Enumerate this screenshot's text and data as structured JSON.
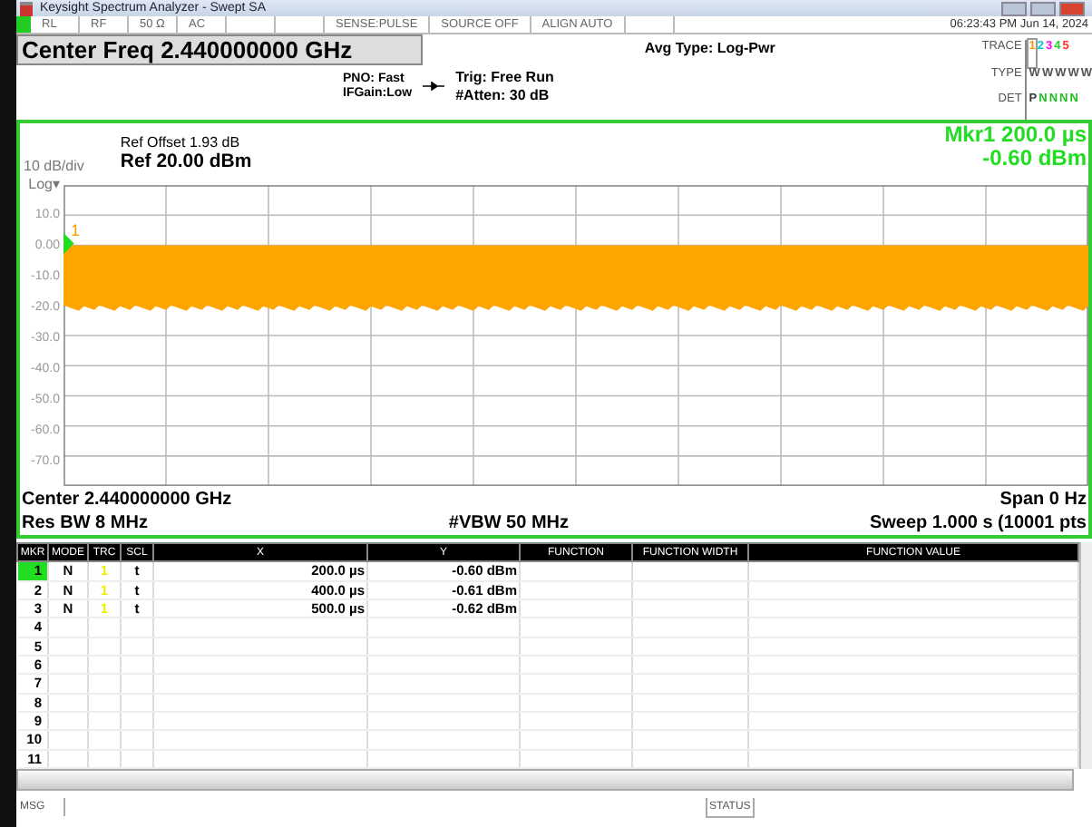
{
  "window": {
    "title": "Keysight Spectrum Analyzer - Swept SA"
  },
  "status_row": {
    "cells": [
      "RL",
      "RF",
      "50 Ω",
      "AC",
      "",
      "",
      "SENSE:PULSE",
      "SOURCE OFF",
      "ALIGN AUTO",
      ""
    ],
    "time": "06:23:43 PM Jun 14, 2024"
  },
  "center_freq": "Center Freq 2.440000000 GHz",
  "settings": {
    "pno": "PNO: Fast",
    "ifgain": "IFGain:Low",
    "trig": "Trig: Free Run",
    "atten": "#Atten: 30 dB",
    "avg_type": "Avg Type: Log-Pwr"
  },
  "trace_info": {
    "trace_label": "TRACE",
    "type_label": "TYPE",
    "det_label": "DET",
    "traces": [
      {
        "number": "1",
        "type": "W",
        "det": "P",
        "color": "#ff9900",
        "selected": true
      },
      {
        "number": "2",
        "type": "W",
        "det": "N",
        "color": "#00c8c8",
        "selected": false
      },
      {
        "number": "3",
        "type": "W",
        "det": "N",
        "color": "#ff00ff",
        "selected": false
      },
      {
        "number": "4",
        "type": "W",
        "det": "N",
        "color": "#33cc33",
        "selected": false
      },
      {
        "number": "5",
        "type": "W",
        "det": "N",
        "color": "#ff3333",
        "selected": false
      }
    ]
  },
  "graph": {
    "scale": "10 dB/div",
    "log": "Log▾",
    "ref_offset": "Ref Offset 1.93 dB",
    "ref_level": "Ref 20.00 dBm",
    "marker_x": "Mkr1 200.0 µs",
    "marker_y": "-0.60 dBm",
    "marker_label": "1",
    "y_labels": [
      "10.0",
      "0.00",
      "-10.0",
      "-20.0",
      "-30.0",
      "-40.0",
      "-50.0",
      "-60.0",
      "-70.0"
    ],
    "center": "Center 2.440000000 GHz",
    "span": "Span 0 Hz",
    "res_bw": "Res BW 8 MHz",
    "vbw": "#VBW 50 MHz",
    "sweep": "Sweep  1.000 s (10001 pts"
  },
  "marker_table": {
    "columns": [
      "MKR",
      "MODE",
      "TRC",
      "SCL",
      "X",
      "Y",
      "FUNCTION",
      "FUNCTION WIDTH",
      "FUNCTION VALUE"
    ],
    "rows": [
      {
        "mkr": "1",
        "mode": "N",
        "trc": "1",
        "scl": "t",
        "x": "200.0 µs",
        "y": "-0.60 dBm",
        "selected": true
      },
      {
        "mkr": "2",
        "mode": "N",
        "trc": "1",
        "scl": "t",
        "x": "400.0 µs",
        "y": "-0.61 dBm",
        "selected": false
      },
      {
        "mkr": "3",
        "mode": "N",
        "trc": "1",
        "scl": "t",
        "x": "500.0 µs",
        "y": "-0.62 dBm",
        "selected": false
      },
      {
        "mkr": "4",
        "selected": false
      },
      {
        "mkr": "5",
        "selected": false
      },
      {
        "mkr": "6",
        "selected": false
      },
      {
        "mkr": "7",
        "selected": false
      },
      {
        "mkr": "8",
        "selected": false
      },
      {
        "mkr": "9",
        "selected": false
      },
      {
        "mkr": "10",
        "selected": false
      },
      {
        "mkr": "11",
        "selected": false
      }
    ]
  },
  "status_bar": {
    "msg": "MSG",
    "status": "STATUS"
  }
}
